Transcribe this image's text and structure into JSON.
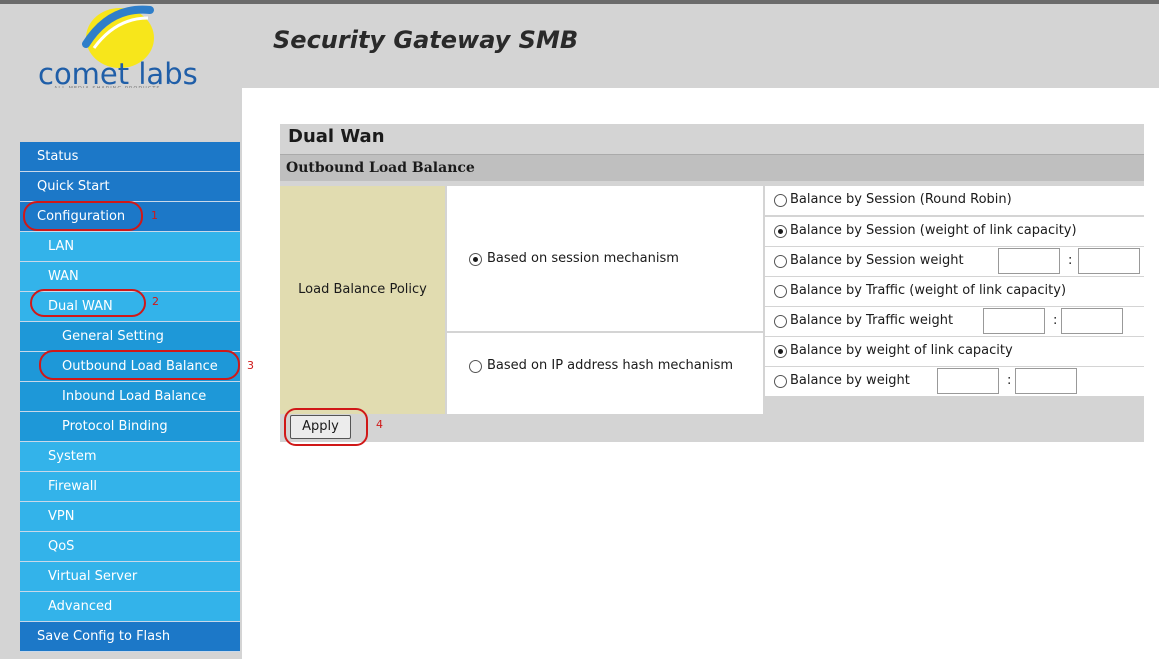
{
  "header": {
    "logo_text": "comet labs",
    "logo_tagline": "ALL MEDIA SHARING PRODUCTS",
    "title": "Security Gateway SMB"
  },
  "nav": {
    "status": "Status",
    "quick_start": "Quick Start",
    "configuration": "Configuration",
    "lan": "LAN",
    "wan": "WAN",
    "dual_wan": "Dual WAN",
    "general_setting": "General Setting",
    "outbound_load_balance": "Outbound Load Balance",
    "inbound_load_balance": "Inbound Load Balance",
    "protocol_binding": "Protocol Binding",
    "system": "System",
    "firewall": "Firewall",
    "vpn": "VPN",
    "qos": "QoS",
    "virtual_server": "Virtual Server",
    "advanced": "Advanced",
    "save_config": "Save Config to Flash"
  },
  "annotations": {
    "step1": "1",
    "step2": "2",
    "step3": "3",
    "step4": "4"
  },
  "main": {
    "panel_title": "Dual Wan",
    "section_title": "Outbound Load Balance",
    "policy_label": "Load Balance Policy",
    "mech_session": "Based on session mechanism",
    "mech_hash": "Based on IP address hash mechanism",
    "opt_round_robin": "Balance by Session (Round Robin)",
    "opt_session_capacity": "Balance by Session (weight of link capacity)",
    "opt_session_weight": "Balance by Session weight",
    "opt_traffic_capacity": "Balance by Traffic (weight of link capacity)",
    "opt_traffic_weight": "Balance by Traffic weight",
    "opt_hash_capacity": "Balance by weight of link capacity",
    "opt_hash_weight": "Balance by weight",
    "colon": ":",
    "apply": "Apply"
  },
  "colors": {
    "nav_top": "#1c78c8",
    "nav_sub": "#33b3ea",
    "nav_sub2": "#1e98d8",
    "annotation": "#d01818",
    "policy_cell": "#e1dcb0"
  }
}
